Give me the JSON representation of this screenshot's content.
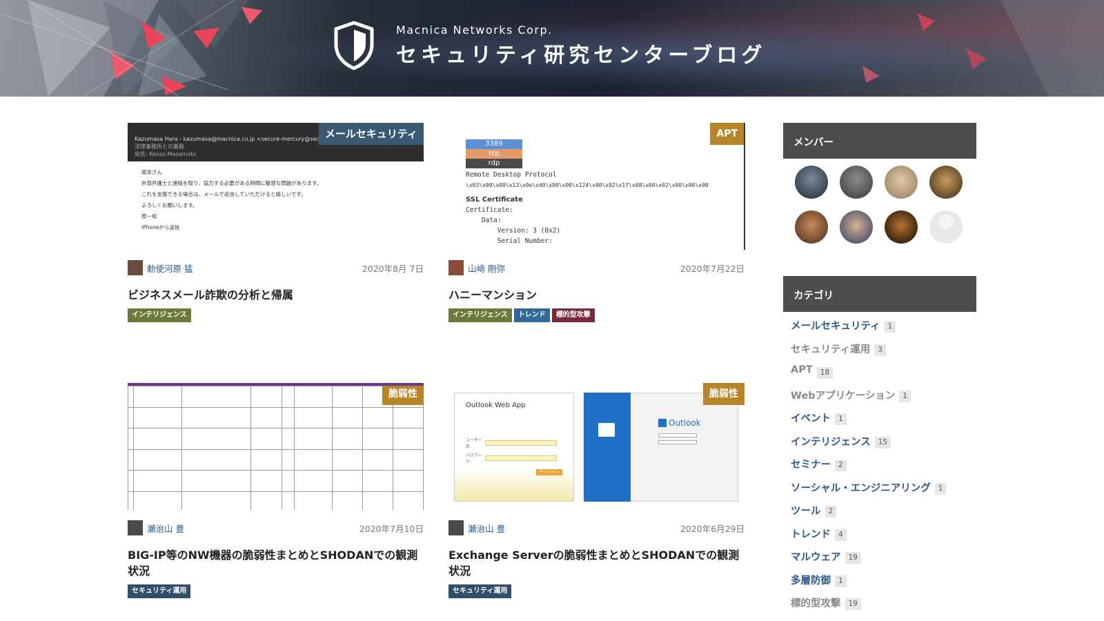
{
  "header": {
    "company": "Macnica Networks Corp.",
    "blog_title": "セキュリティ研究センターブログ"
  },
  "posts": [
    {
      "category_badge": "メールセキュリティ",
      "badge_color": "#3a5a73",
      "author": "勅使河原 猛",
      "date": "2020年8月 7日",
      "title": "ビジネスメール詐欺の分析と帰属",
      "tags": [
        {
          "label": "インテリジェンス",
          "color": "#6b7a3a"
        }
      ],
      "thumb": {
        "from_line": "Kazumasa Hara - kazumasa@macnica.co.jp <secure-mercury@secure-server",
        "sub1": "法律事務所との業務",
        "sub2": "宛先: Kenzo Masamoto",
        "body": [
          "政本さん",
          "外部弁護士と連絡を取り、協力する必要がある時間に敏感な問題があります。",
          "これを支援できる場合は、メールで返信していただけると嬉しいです。",
          "よろしくお願いします。",
          "原一和",
          "iPhoneから送信"
        ]
      }
    },
    {
      "category_badge": "APT",
      "badge_color": "#b8862a",
      "author": "山﨑 剛弥",
      "date": "2020年7月22日",
      "title": "ハニーマンション",
      "tags": [
        {
          "label": "インテリジェンス",
          "color": "#6b7a3a"
        },
        {
          "label": "トレンド",
          "color": "#2f6a9a"
        },
        {
          "label": "標的型攻撃",
          "color": "#7a2a3a"
        }
      ],
      "thumb": {
        "boxes": [
          "3389",
          "tcp",
          "rdp"
        ],
        "lines": [
          "Remote Desktop Protocol",
          "\\x03\\x00\\x00\\x13\\x0e\\xd0\\x00\\x00\\x124\\x00\\x02\\x1f\\x08\\x00\\x02\\x00\\x00\\x00",
          "SSL Certificate",
          "Certificate:",
          "    Data:",
          "        Version: 3 (0x2)",
          "        Serial Number:"
        ]
      }
    },
    {
      "category_badge": "脆弱性",
      "badge_color": "#b8862a",
      "author": "瀬治山 豊",
      "date": "2020年7月10日",
      "title": "BIG-IP等のNW機器の脆弱性まとめとSHODANでの観測状況",
      "tags": [
        {
          "label": "セキュリティ運用",
          "color": "#2f4f6a"
        }
      ]
    },
    {
      "category_badge": "脆弱性",
      "badge_color": "#b8862a",
      "author": "瀬治山 豊",
      "date": "2020年6月29日",
      "title": "Exchange Serverの脆弱性まとめとSHODANでの観測状況",
      "tags": [
        {
          "label": "セキュリティ運用",
          "color": "#2f4f6a"
        }
      ],
      "thumb": {
        "owa_title": "Outlook Web App",
        "owa_user": "ユーザー名:",
        "owa_pass": "パスワード:",
        "owa_signin": "サインイン",
        "outlook_label": "Outlook"
      }
    }
  ],
  "sidebar": {
    "members_title": "メンバー",
    "categories_title": "カテゴリ",
    "categories": [
      {
        "label": "メールセキュリティ",
        "count": "1",
        "style": "link"
      },
      {
        "label": "セキュリティ運用",
        "count": "3",
        "style": "gray"
      },
      {
        "label": "APT",
        "count": "18",
        "style": "gray"
      },
      {
        "label": "Webアプリケーション",
        "count": "1",
        "style": "gray"
      },
      {
        "label": "イベント",
        "count": "1",
        "style": "link"
      },
      {
        "label": "インテリジェンス",
        "count": "15",
        "style": "link"
      },
      {
        "label": "セミナー",
        "count": "2",
        "style": "link"
      },
      {
        "label": "ソーシャル・エンジニアリング",
        "count": "1",
        "style": "link"
      },
      {
        "label": "ツール",
        "count": "2",
        "style": "link"
      },
      {
        "label": "トレンド",
        "count": "4",
        "style": "link"
      },
      {
        "label": "マルウェア",
        "count": "19",
        "style": "link"
      },
      {
        "label": "多層防御",
        "count": "1",
        "style": "link"
      },
      {
        "label": "標的型攻撃",
        "count": "19",
        "style": "gray"
      }
    ]
  }
}
